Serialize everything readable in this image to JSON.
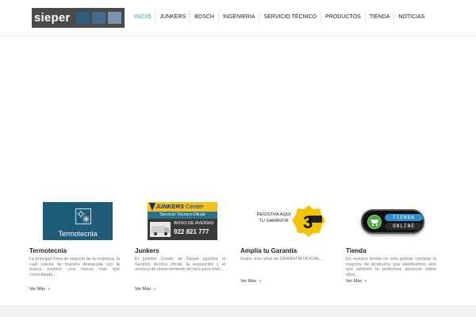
{
  "header": {
    "logo_text": "sieper",
    "nav": [
      {
        "label": "INICIO",
        "active": true
      },
      {
        "label": "JUNKERS",
        "active": false
      },
      {
        "label": "BOSCH",
        "active": false
      },
      {
        "label": "INGENIERIA",
        "active": false
      },
      {
        "label": "SERVICIO TÉCNICO",
        "active": false
      },
      {
        "label": "PRODUCTOS",
        "active": false
      },
      {
        "label": "TIENDA",
        "active": false
      },
      {
        "label": "NOTICIAS",
        "active": false
      }
    ]
  },
  "colors": {
    "accent": "#3aa0c8",
    "logo_bg": "#4a4a4a",
    "termo_bg": "#1e5c78",
    "junkers_yellow": "#f1c11c",
    "tienda_green": "#3fae3a"
  },
  "features": [
    {
      "title": "Termotecnia",
      "thumb_label": "Termotecnia",
      "description": "La principal línea de negocio de la empresa, la cual cuenta de manera destacada con la marca junkers, una marca más que consolidada...",
      "more": "Ver Más"
    },
    {
      "title": "Junkers",
      "thumb": {
        "brand": "JUNKERS",
        "brand_suffix": "Center",
        "service": "Servicio Técnico Oficial",
        "aviso": "AVISO DE AVERÍAS",
        "phone": "922 821 777"
      },
      "description": "El junkers Center de Sieper aglutina el Servicio técnico oficial, la exposición y el servicio de asesoramiento técnico para todo...",
      "more": "Ver Más"
    },
    {
      "title": "Amplía tu Garantía",
      "thumb": {
        "text_line1": "REGISTRA AQUÍ",
        "text_line2": "TU GARANTÍA",
        "badge_number": "3"
      },
      "description": "Gratis, tres años de GARANTÍA OFICIAL...",
      "more": "Ver Más"
    },
    {
      "title": "Tienda",
      "thumb": {
        "word1": "TIENDA",
        "word2": "ONLINE"
      },
      "description": "En nuestra tienda no solo podrás comprar la mayoría de productos que distribuimos sino que también te podremos asesorar sobre ellos...",
      "more": "Ver Más"
    }
  ]
}
